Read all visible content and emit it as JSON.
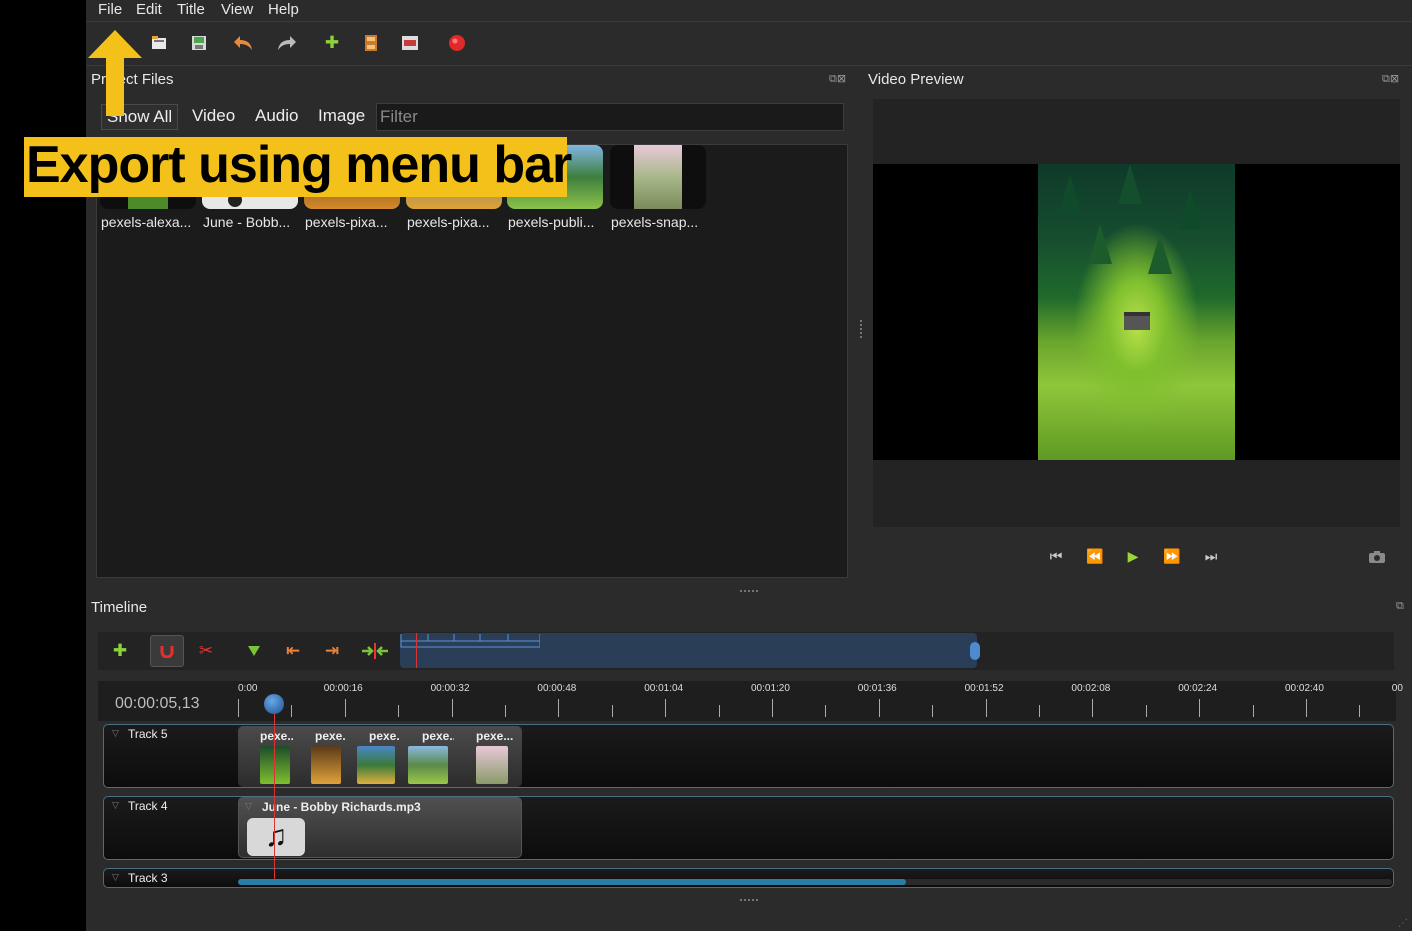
{
  "menu": [
    "File",
    "Edit",
    "Title",
    "View",
    "Help"
  ],
  "panels": {
    "project_files": "Project Files",
    "video_preview": "Video Preview",
    "timeline": "Timeline"
  },
  "filters": {
    "tabs": [
      "Show All",
      "Video",
      "Audio",
      "Image"
    ],
    "placeholder": "Filter"
  },
  "files": [
    {
      "name": "pexels-alexa..."
    },
    {
      "name": "June - Bobb..."
    },
    {
      "name": "pexels-pixa..."
    },
    {
      "name": "pexels-pixa..."
    },
    {
      "name": "pexels-publi..."
    },
    {
      "name": "pexels-snap..."
    }
  ],
  "timeline": {
    "current_time": "00:00:05,13",
    "ruler_labels": [
      "0:00",
      "00:00:16",
      "00:00:32",
      "00:00:48",
      "00:01:04",
      "00:01:20",
      "00:01:36",
      "00:01:52",
      "00:02:08",
      "00:02:24",
      "00:02:40",
      "00"
    ],
    "tracks": [
      "Track 5",
      "Track 4",
      "Track 3"
    ],
    "clips": [
      "pexe...",
      "pexe...",
      "pexe...",
      "pexe...",
      "pexe..."
    ],
    "audio_clip": "June - Bobby Richards.mp3"
  },
  "annotation": "Export using menu bar",
  "colors": {
    "annotation_bg": "#f4c01a",
    "accent_blue": "#2a8ab0",
    "playhead": "#d33333"
  },
  "icons": {
    "toolbar": [
      "open-project-icon",
      "save-project-icon",
      "undo-icon",
      "redo-icon",
      "import-files-icon",
      "profile-icon",
      "fullscreen-icon",
      "export-video-icon"
    ],
    "timeline_toolbar": [
      "add-track-icon",
      "snap-icon",
      "razor-icon",
      "add-marker-icon",
      "previous-marker-icon",
      "next-marker-icon",
      "center-playhead-icon"
    ],
    "playback": [
      "jump-start-icon",
      "rewind-icon",
      "play-icon",
      "fast-forward-icon",
      "jump-end-icon",
      "snapshot-icon"
    ]
  }
}
